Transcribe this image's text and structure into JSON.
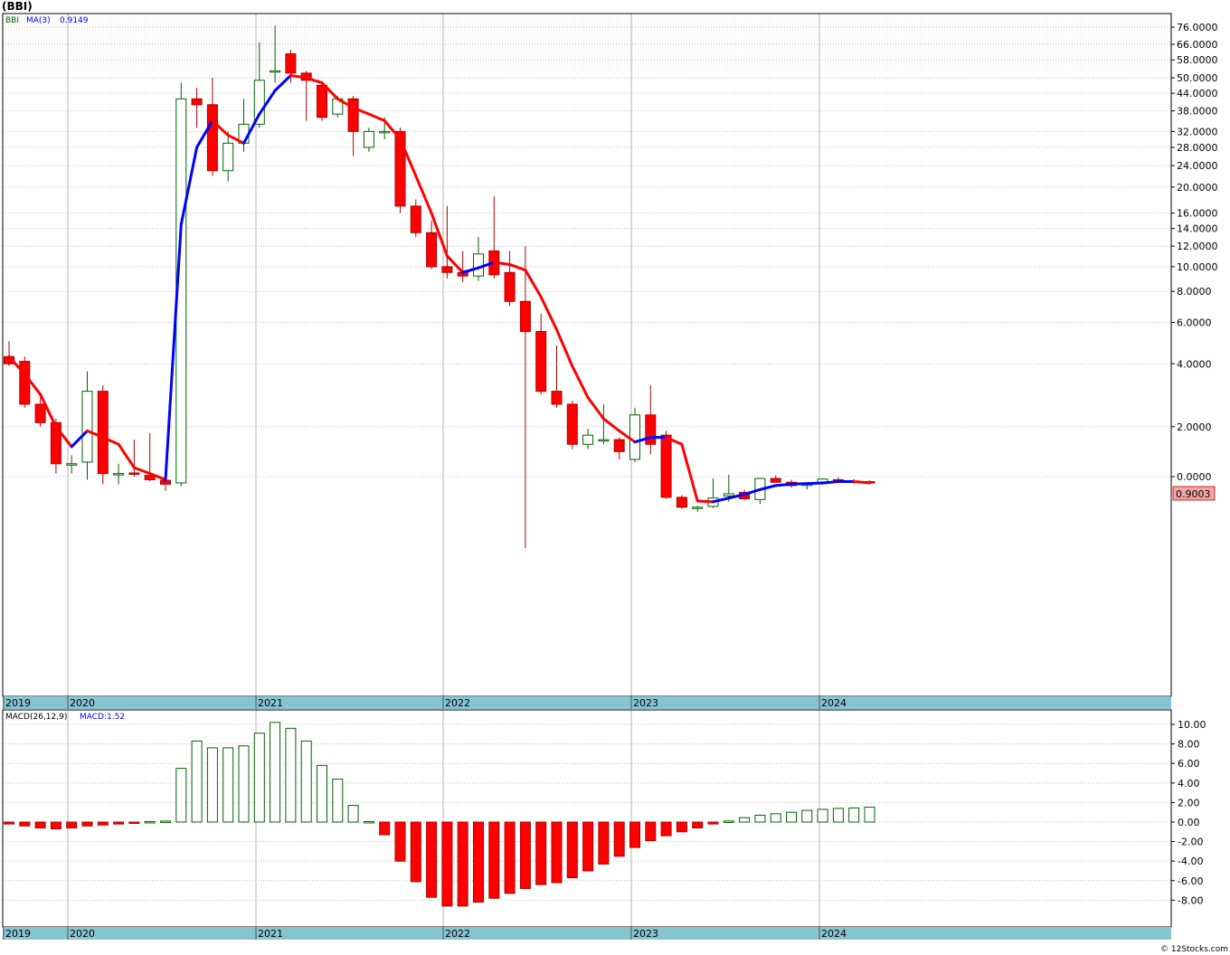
{
  "header": {
    "symbol": "(BBI)"
  },
  "legend": {
    "symbol_label": "BBI",
    "ma_label": "MA(3)",
    "ma_value": "0.9149",
    "macd_label": "MACD(26,12,9)",
    "macd_value_label": "MACD:1.52"
  },
  "last_price_label": "0.9003",
  "watermark": "© 12Stocks.com",
  "colors": {
    "up": "#006400",
    "down": "#ff0000",
    "ma_up": "#0000ff",
    "ma_down": "#ff0000",
    "axis_band": "#87c4d2",
    "grid": "#b4b4b4",
    "price_box": "#f4a6a6"
  },
  "chart_data": [
    {
      "type": "candlestick",
      "title": "(BBI)",
      "scale": "log",
      "y_ticks": [
        "76.0000",
        "66.0000",
        "58.0000",
        "50.0000",
        "44.0000",
        "38.0000",
        "32.0000",
        "28.0000",
        "24.0000",
        "20.0000",
        "16.0000",
        "14.0000",
        "12.0000",
        "10.0000",
        "8.0000",
        "6.0000",
        "4.0000",
        "2.0000",
        "0.0000"
      ],
      "x_ticks": [
        "2019",
        "2020",
        "2021",
        "2022",
        "2023",
        "2024"
      ],
      "grid": true,
      "ma_period": 3,
      "series": [
        {
          "name": "BBI",
          "candles": [
            {
              "o": 4.3,
              "h": 5.0,
              "l": 3.9,
              "c": 4.0
            },
            {
              "o": 4.1,
              "h": 4.3,
              "l": 2.5,
              "c": 2.6
            },
            {
              "o": 2.6,
              "h": 2.8,
              "l": 2.0,
              "c": 2.1
            },
            {
              "o": 2.1,
              "h": 2.2,
              "l": 1.05,
              "c": 1.22
            },
            {
              "o": 1.22,
              "h": 1.38,
              "l": 1.05,
              "c": 1.22
            },
            {
              "o": 1.25,
              "h": 3.7,
              "l": 0.95,
              "c": 3.0
            },
            {
              "o": 3.0,
              "h": 3.2,
              "l": 0.88,
              "c": 1.05
            },
            {
              "o": 1.05,
              "h": 1.22,
              "l": 0.88,
              "c": 1.05
            },
            {
              "o": 1.06,
              "h": 1.7,
              "l": 1.0,
              "c": 1.05
            },
            {
              "o": 1.02,
              "h": 1.85,
              "l": 0.93,
              "c": 0.95
            },
            {
              "o": 0.94,
              "h": 1.05,
              "l": 0.78,
              "c": 0.88
            },
            {
              "o": 0.9,
              "h": 48,
              "l": 0.85,
              "c": 42
            },
            {
              "o": 42,
              "h": 46,
              "l": 33,
              "c": 40
            },
            {
              "o": 40,
              "h": 50,
              "l": 22,
              "c": 23
            },
            {
              "o": 23,
              "h": 32,
              "l": 21,
              "c": 29
            },
            {
              "o": 29,
              "h": 42,
              "l": 27,
              "c": 34
            },
            {
              "o": 34,
              "h": 67,
              "l": 33,
              "c": 49
            },
            {
              "o": 53,
              "h": 77,
              "l": 48,
              "c": 53
            },
            {
              "o": 61,
              "h": 63,
              "l": 48,
              "c": 52
            },
            {
              "o": 52,
              "h": 53,
              "l": 35,
              "c": 49
            },
            {
              "o": 47,
              "h": 48,
              "l": 35,
              "c": 36
            },
            {
              "o": 37,
              "h": 43,
              "l": 36,
              "c": 42
            },
            {
              "o": 42,
              "h": 43,
              "l": 26,
              "c": 32
            },
            {
              "o": 28,
              "h": 33,
              "l": 27,
              "c": 32
            },
            {
              "o": 32,
              "h": 36,
              "l": 30,
              "c": 32
            },
            {
              "o": 32,
              "h": 33,
              "l": 16,
              "c": 17
            },
            {
              "o": 17,
              "h": 18,
              "l": 13,
              "c": 13.5
            },
            {
              "o": 13.5,
              "h": 15,
              "l": 9.8,
              "c": 10
            },
            {
              "o": 10,
              "h": 17,
              "l": 9.0,
              "c": 9.5
            },
            {
              "o": 9.5,
              "h": 11.5,
              "l": 8.7,
              "c": 9.2
            },
            {
              "o": 9.2,
              "h": 13,
              "l": 8.8,
              "c": 11.2
            },
            {
              "o": 11.5,
              "h": 18.5,
              "l": 9.0,
              "c": 9.3
            },
            {
              "o": 9.5,
              "h": 11.5,
              "l": 7.0,
              "c": 7.3
            },
            {
              "o": 7.3,
              "h": 12,
              "l": 0.12,
              "c": 5.5
            },
            {
              "o": 5.5,
              "h": 6.5,
              "l": 2.9,
              "c": 3.0
            },
            {
              "o": 3.0,
              "h": 4.8,
              "l": 2.5,
              "c": 2.6
            },
            {
              "o": 2.6,
              "h": 2.7,
              "l": 1.5,
              "c": 1.6
            },
            {
              "o": 1.6,
              "h": 1.95,
              "l": 1.5,
              "c": 1.8
            },
            {
              "o": 1.7,
              "h": 2.6,
              "l": 1.6,
              "c": 1.7
            },
            {
              "o": 1.7,
              "h": 1.75,
              "l": 1.3,
              "c": 1.45
            },
            {
              "o": 1.3,
              "h": 2.5,
              "l": 1.25,
              "c": 2.3
            },
            {
              "o": 2.3,
              "h": 3.2,
              "l": 1.4,
              "c": 1.6
            },
            {
              "o": 1.8,
              "h": 1.9,
              "l": 0.67,
              "c": 0.69
            },
            {
              "o": 0.69,
              "h": 0.72,
              "l": 0.54,
              "c": 0.56
            },
            {
              "o": 0.56,
              "h": 0.58,
              "l": 0.5,
              "c": 0.56
            },
            {
              "o": 0.57,
              "h": 0.97,
              "l": 0.55,
              "c": 0.68
            },
            {
              "o": 0.71,
              "h": 1.03,
              "l": 0.63,
              "c": 0.74
            },
            {
              "o": 0.76,
              "h": 0.8,
              "l": 0.65,
              "c": 0.67
            },
            {
              "o": 0.66,
              "h": 0.98,
              "l": 0.6,
              "c": 0.97
            },
            {
              "o": 0.97,
              "h": 1.02,
              "l": 0.92,
              "c": 0.91
            },
            {
              "o": 0.91,
              "h": 0.95,
              "l": 0.83,
              "c": 0.86
            },
            {
              "o": 0.86,
              "h": 0.91,
              "l": 0.8,
              "c": 0.89
            },
            {
              "o": 0.89,
              "h": 0.97,
              "l": 0.87,
              "c": 0.96
            },
            {
              "o": 0.95,
              "h": 0.99,
              "l": 0.9,
              "c": 0.92
            },
            {
              "o": 0.93,
              "h": 0.96,
              "l": 0.88,
              "c": 0.92
            },
            {
              "o": 0.92,
              "h": 0.94,
              "l": 0.88,
              "c": 0.9
            }
          ]
        },
        {
          "name": "MA(3)",
          "values": [
            4.3,
            3.6,
            2.9,
            2.0,
            1.55,
            1.9,
            1.75,
            1.6,
            1.15,
            1.05,
            0.95,
            14.5,
            28,
            35,
            31,
            29,
            37,
            45,
            51,
            50,
            48,
            42,
            39,
            37,
            35,
            30,
            22,
            16,
            11,
            9.5,
            9.9,
            10.4,
            10.2,
            9.7,
            7.6,
            5.6,
            3.9,
            2.8,
            2.2,
            1.9,
            1.65,
            1.75,
            1.75,
            1.6,
            0.64,
            0.63,
            0.68,
            0.73,
            0.8,
            0.86,
            0.88,
            0.89,
            0.9,
            0.92,
            0.92,
            0.9
          ]
        }
      ]
    },
    {
      "type": "bar",
      "title": "MACD(26,12,9)",
      "ylim": [
        -8.8,
        11.0
      ],
      "y_ticks": [
        "10.00",
        "8.00",
        "6.00",
        "4.00",
        "2.00",
        "0.00",
        "-2.00",
        "-4.00",
        "-6.00",
        "-8.00"
      ],
      "x_ticks": [
        "2019",
        "2020",
        "2021",
        "2022",
        "2023",
        "2024"
      ],
      "series": [
        {
          "name": "MACD",
          "values": [
            -0.2,
            -0.4,
            -0.6,
            -0.7,
            -0.6,
            -0.4,
            -0.3,
            -0.2,
            -0.1,
            0.05,
            0.1,
            5.5,
            8.3,
            7.6,
            7.6,
            7.8,
            9.1,
            10.2,
            9.6,
            8.3,
            5.8,
            4.4,
            1.7,
            0.05,
            -1.3,
            -4.0,
            -6.1,
            -7.7,
            -8.6,
            -8.6,
            -8.2,
            -7.8,
            -7.3,
            -6.8,
            -6.4,
            -6.2,
            -5.7,
            -5.0,
            -4.3,
            -3.5,
            -2.6,
            -1.9,
            -1.4,
            -1.0,
            -0.6,
            -0.2,
            0.1,
            0.45,
            0.7,
            0.85,
            1.0,
            1.2,
            1.3,
            1.4,
            1.45,
            1.52
          ]
        }
      ]
    }
  ]
}
